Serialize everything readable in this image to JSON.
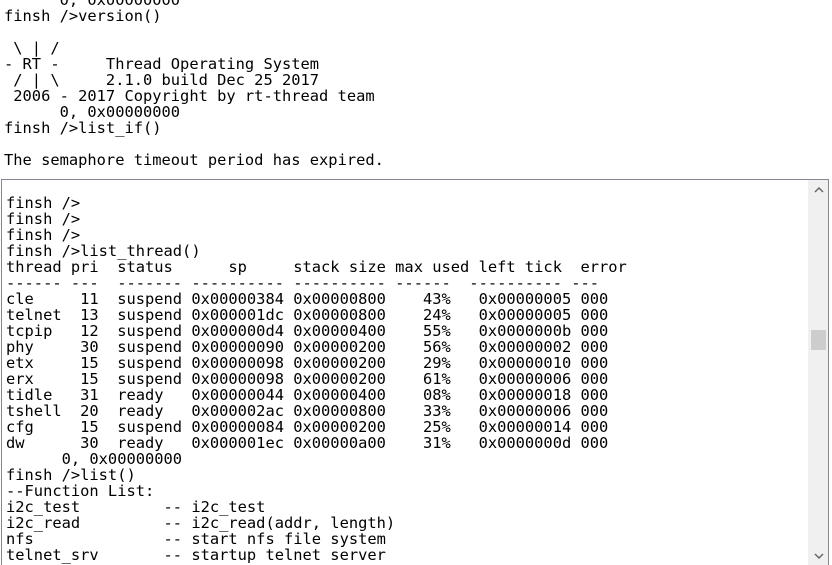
{
  "top_console": {
    "lines": [
      "      0, 0x00000000",
      "finsh />version()",
      "",
      " \\ | /",
      "- RT -     Thread Operating System",
      " / | \\     2.1.0 build Dec 25 2017",
      " 2006 - 2017 Copyright by rt-thread team",
      "      0, 0x00000000",
      "finsh />list_if()",
      "",
      "The semaphore timeout period has expired."
    ]
  },
  "bottom_console": {
    "lines": [
      "finsh />",
      "finsh />",
      "finsh />",
      "finsh />list_thread()",
      "thread pri  status      sp     stack size max used left tick  error",
      "------ ---  ------- ---------- ---------- ------  ---------- ---",
      "cle     11  suspend 0x00000384 0x00000800    43%   0x00000005 000",
      "telnet  13  suspend 0x000001dc 0x00000800    24%   0x00000005 000",
      "tcpip   12  suspend 0x000000d4 0x00000400    55%   0x0000000b 000",
      "phy     30  suspend 0x00000090 0x00000200    56%   0x00000002 000",
      "etx     15  suspend 0x00000098 0x00000200    29%   0x00000010 000",
      "erx     15  suspend 0x00000098 0x00000200    61%   0x00000006 000",
      "tidle   31  ready   0x00000044 0x00000400    08%   0x00000018 000",
      "tshell  20  ready   0x000002ac 0x00000800    33%   0x00000006 000",
      "cfg     15  suspend 0x00000084 0x00000200    25%   0x00000014 000",
      "dw      30  ready   0x000001ec 0x00000a00    31%   0x0000000d 000",
      "      0, 0x00000000",
      "finsh />list()",
      "--Function List:",
      "i2c_test         -- i2c_test",
      "i2c_read         -- i2c_read(addr, length)",
      "nfs              -- start nfs file system",
      "telnet_srv       -- startup telnet server"
    ]
  },
  "scrollbar": {
    "up_icon": "chevron-up-icon",
    "down_icon": "chevron-down-icon",
    "track_color": "#f0f0f0",
    "thumb_color": "#cdcdcd",
    "position_fraction": 0.42
  }
}
